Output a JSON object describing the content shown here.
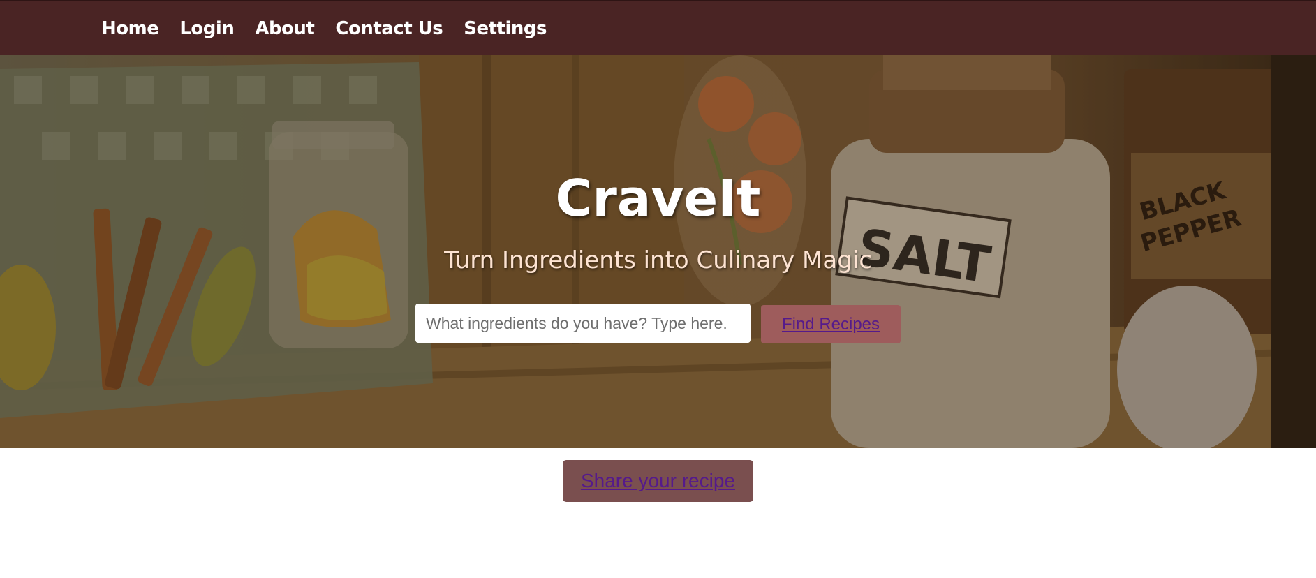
{
  "nav": {
    "items": [
      {
        "label": "Home"
      },
      {
        "label": "Login"
      },
      {
        "label": "About"
      },
      {
        "label": "Contact Us"
      },
      {
        "label": "Settings"
      }
    ]
  },
  "hero": {
    "title": "CraveIt",
    "subtitle": "Turn Ingredients into Culinary Magic",
    "background_image": "illustrated-pantry-shelf",
    "labels_in_image": [
      "SALT",
      "BLACK PEPPER"
    ]
  },
  "search": {
    "placeholder": "What ingredients do you have? Type here.",
    "value": "",
    "button_label": "Find Recipes"
  },
  "share": {
    "button_label": "Share your recipe"
  },
  "colors": {
    "nav_background": "#4a2424",
    "find_button": "#9e5c5c",
    "share_button": "#7a4f4f",
    "link_text": "#551a8b",
    "subtitle_text": "#fde3d2"
  }
}
